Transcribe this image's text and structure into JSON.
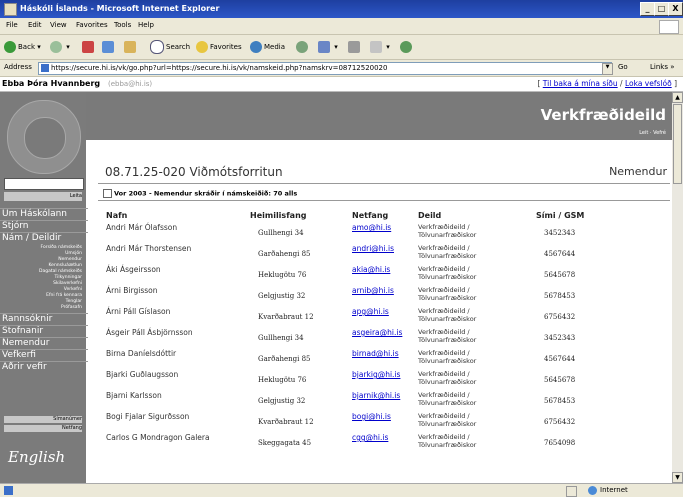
{
  "window": {
    "title": "Háskóli Íslands - Microsoft Internet Explorer",
    "min": "_",
    "max": "□",
    "close": "X"
  },
  "menu": [
    "File",
    "Edit",
    "View",
    "Favorites",
    "Tools",
    "Help"
  ],
  "toolbar": {
    "back": "Back",
    "search": "Search",
    "favorites": "Favorites",
    "media": "Media"
  },
  "address": {
    "label": "Address",
    "url": "https://secure.hi.is/vk/go.php?url=https://secure.hi.is/vk/namskeid.php?namskrv=08712520020",
    "go": "Go",
    "links": "Links »"
  },
  "userbar": {
    "user": "Ebba Þóra Hvannberg",
    "email": "(ebba@hi.is)",
    "back_link": "Til baka á mína síðu",
    "close_link": "Loka vefslóð",
    "open_bracket": "[",
    "sep": "/",
    "close_bracket": "]"
  },
  "sidebar": {
    "search_button": "Leita",
    "nav1": [
      "Um Háskólann",
      "Stjórn",
      "Nám / Deildir"
    ],
    "sub": [
      "Forsíða námskeiðs",
      "Umsjón",
      "Nemendur",
      "Kennsluáætlun",
      "Dagatal námskeiðs",
      "Tilkynningar",
      "Skilaverkefni",
      "Verkefni",
      "Efni frá kennara",
      "Tenglar",
      "Prófasafn"
    ],
    "nav2": [
      "Rannsóknir",
      "Stofnanir",
      "Nemendur",
      "Vefkerfi",
      "Aðrir vefir"
    ],
    "grey_buttons": [
      "Símanúmer",
      "Netfang"
    ],
    "english": "English"
  },
  "banner": {
    "title": "Verkfræðideild",
    "links": "Leit · Vefré"
  },
  "course": {
    "title": "08.71.25-020 Viðmótsforritun",
    "role": "Nemendur",
    "subtitle": "Vor 2003 - Nemendur skráðir í námskeiðið: 70 alls"
  },
  "table": {
    "headers": [
      "Nafn",
      "Heimilisfang",
      "Netfang",
      "Deild",
      "Sími / GSM"
    ],
    "rows": [
      {
        "name": "Andri Már Ólafsson",
        "address": "Gullhengi 34",
        "email": "amo@hi.is",
        "dept1": "Verkfræðideild /",
        "dept2": "Tölvunarfræðiskor",
        "phone": "3452343"
      },
      {
        "name": "Andri Már Thorstensen",
        "address": "Garðahengi 85",
        "email": "andri@hi.is",
        "dept1": "Verkfræðideild /",
        "dept2": "Tölvunarfræðiskor",
        "phone": "4567644"
      },
      {
        "name": "Áki Ásgeirsson",
        "address": "Heklugötu 76",
        "email": "akia@hi.is",
        "dept1": "Verkfræðideild /",
        "dept2": "Tölvunarfræðiskor",
        "phone": "5645678"
      },
      {
        "name": "Árni Birgisson",
        "address": "Gelgjustig 32",
        "email": "arnib@hi.is",
        "dept1": "Verkfræðideild /",
        "dept2": "Tölvunarfræðiskor",
        "phone": "5678453"
      },
      {
        "name": "Árni Páll Gíslason",
        "address": "Kvarðabraut 12",
        "email": "apg@hi.is",
        "dept1": "Verkfræðideild /",
        "dept2": "Tölvunarfræðiskor",
        "phone": "6756432"
      },
      {
        "name": "Ásgeir Páll Ásbjörnsson",
        "address": "Gullhengi 34",
        "email": "asgeira@hi.is",
        "dept1": "Verkfræðideild /",
        "dept2": "Tölvunarfræðiskor",
        "phone": "3452343"
      },
      {
        "name": "Birna Daníelsdóttir",
        "address": "Garðahengi 85",
        "email": "birnad@hi.is",
        "dept1": "Verkfræðideild /",
        "dept2": "Tölvunarfræðiskor",
        "phone": "4567644"
      },
      {
        "name": "Bjarki Guðlaugsson",
        "address": "Heklugötu 76",
        "email": "bjarkig@hi.is",
        "dept1": "Verkfræðideild /",
        "dept2": "Tölvunarfræðiskor",
        "phone": "5645678"
      },
      {
        "name": "Bjarni Karlsson",
        "address": "Gelgjustig 32",
        "email": "bjarnik@hi.is",
        "dept1": "Verkfræðideild /",
        "dept2": "Tölvunarfræðiskor",
        "phone": "5678453"
      },
      {
        "name": "Bogi Fjalar Sigurðsson",
        "address": "Kvarðabraut 12",
        "email": "bogi@hi.is",
        "dept1": "Verkfræðideild /",
        "dept2": "Tölvunarfræðiskor",
        "phone": "6756432"
      },
      {
        "name": "Carlos G Mondragon Galera",
        "address": "Skeggagata 45",
        "email": "cgg@hi.is",
        "dept1": "Verkfræðideild /",
        "dept2": "Tölvunarfræðiskor",
        "phone": "7654098"
      }
    ]
  },
  "status": {
    "zone": "Internet"
  },
  "colors": {
    "titlebar": "#2c57c8",
    "sidebar": "#7b7b7b",
    "banner": "#7a7a7a",
    "link": "#0000cc"
  }
}
